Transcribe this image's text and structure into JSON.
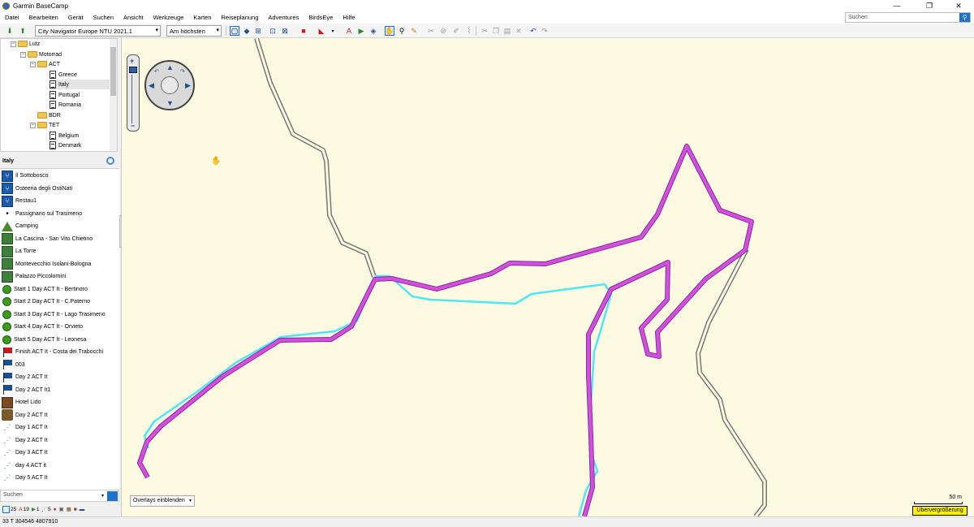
{
  "window": {
    "title": "Garmin BaseCamp",
    "minimize": "—",
    "restore": "❐",
    "close": "✕"
  },
  "menu": [
    "Datei",
    "Bearbeiten",
    "Gerät",
    "Suchen",
    "Ansicht",
    "Werkzeuge",
    "Karten",
    "Reiseplanung",
    "Adventures",
    "BirdsEye",
    "Hilfe"
  ],
  "search": {
    "placeholder": "Suchen"
  },
  "toolbar": {
    "map_product": "City Navigator Europe NTU 2021.1",
    "detail_level": "Am höchsten"
  },
  "tree": {
    "nodes": [
      {
        "label": "Lutz",
        "type": "folder",
        "level": 0
      },
      {
        "label": "Motorrad",
        "type": "folder",
        "level": 1
      },
      {
        "label": "ACT",
        "type": "folder",
        "level": 2
      },
      {
        "label": "Greece",
        "type": "list",
        "level": 3
      },
      {
        "label": "Italy",
        "type": "list",
        "level": 3
      },
      {
        "label": "Portugal",
        "type": "list",
        "level": 3
      },
      {
        "label": "Romania",
        "type": "list",
        "level": 3
      },
      {
        "label": "BDR",
        "type": "folder",
        "level": 2
      },
      {
        "label": "TET",
        "type": "folder",
        "level": 2
      },
      {
        "label": "Belgium",
        "type": "list",
        "level": 3
      },
      {
        "label": "Denmark",
        "type": "list",
        "level": 3
      }
    ]
  },
  "list": {
    "title": "Italy",
    "items": [
      {
        "label": "Il Sottobosco",
        "icon": "restaurant-icon"
      },
      {
        "label": "Osteeria degli OstiNati",
        "icon": "restaurant-icon"
      },
      {
        "label": "Restau1",
        "icon": "restaurant-icon"
      },
      {
        "label": "Passignano sul Trasimeno",
        "icon": "dot-icon"
      },
      {
        "label": "Camping",
        "icon": "camping-icon"
      },
      {
        "label": "La Cascina - San Vito Chietino",
        "icon": "picture-icon"
      },
      {
        "label": "La Torre",
        "icon": "picture-icon"
      },
      {
        "label": "Montevecchio Isolani-Bologna",
        "icon": "picture-icon"
      },
      {
        "label": "Palazzo Piccolomini",
        "icon": "picture-icon"
      },
      {
        "label": "Start 1 Day ACT It - Bertinoro",
        "icon": "green-circle-icon"
      },
      {
        "label": "Start 2 Day ACT It - C.Paterno",
        "icon": "green-circle-icon"
      },
      {
        "label": "Start 3 Day ACT It - Lago Trasimeno",
        "icon": "green-circle-icon"
      },
      {
        "label": "Start 4 Day ACT It - Orvieto",
        "icon": "green-circle-icon"
      },
      {
        "label": "Start 5 Day ACT It - Leonesa",
        "icon": "green-circle-icon"
      },
      {
        "label": "Finish ACT It - Costa dei Trabocchi",
        "icon": "red-flag-icon"
      },
      {
        "label": "003",
        "icon": "blue-flag-icon"
      },
      {
        "label": "Day 2 ACT It",
        "icon": "blue-flag-icon"
      },
      {
        "label": "Day 2 ACT It1",
        "icon": "blue-flag-icon"
      },
      {
        "label": "Hotel Lido",
        "icon": "hotel-icon"
      },
      {
        "label": "Day 2 ACT It",
        "icon": "motorcycle-icon"
      },
      {
        "label": "Day 1 ACT It",
        "icon": "track-icon"
      },
      {
        "label": "Day 2 ACT It",
        "icon": "track-icon"
      },
      {
        "label": "Day 3 ACT It",
        "icon": "track-icon"
      },
      {
        "label": "day 4 ACT it",
        "icon": "track-icon"
      },
      {
        "label": "Day 5 ACT It",
        "icon": "track-icon"
      }
    ]
  },
  "bottom_search": {
    "placeholder": "Suchen"
  },
  "counts": [
    {
      "value": "25",
      "icon": "waypoint-count-icon"
    },
    {
      "value": "19",
      "icon": "route-count-icon"
    },
    {
      "value": "1",
      "icon": "track-count-icon"
    },
    {
      "value": "5",
      "icon": "trackpoint-count-icon"
    }
  ],
  "status": {
    "coordinates": "33 T 304546 4807910"
  },
  "map": {
    "overlays_label": "Overlays einblenden",
    "scale_label": "50 m",
    "magnify_label": "Übervergrößerung",
    "colors": {
      "background": "#fcfbe1",
      "route": "#d24fe0",
      "track": "#4fe6f5",
      "road": "#777777"
    }
  }
}
